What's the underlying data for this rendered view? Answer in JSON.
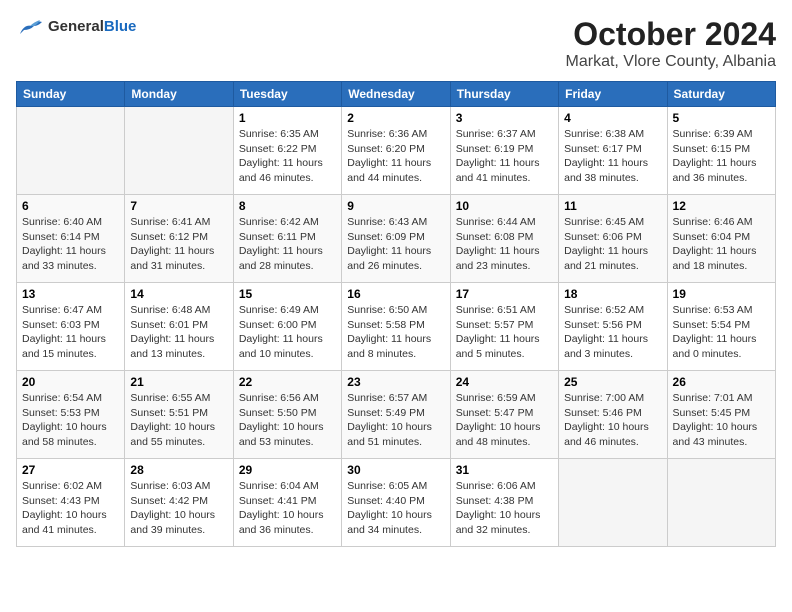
{
  "logo": {
    "general": "General",
    "blue": "Blue"
  },
  "title": "October 2024",
  "subtitle": "Markat, Vlore County, Albania",
  "days_of_week": [
    "Sunday",
    "Monday",
    "Tuesday",
    "Wednesday",
    "Thursday",
    "Friday",
    "Saturday"
  ],
  "weeks": [
    [
      {
        "day": "",
        "sunrise": "",
        "sunset": "",
        "daylight": ""
      },
      {
        "day": "",
        "sunrise": "",
        "sunset": "",
        "daylight": ""
      },
      {
        "day": "1",
        "sunrise": "Sunrise: 6:35 AM",
        "sunset": "Sunset: 6:22 PM",
        "daylight": "Daylight: 11 hours and 46 minutes."
      },
      {
        "day": "2",
        "sunrise": "Sunrise: 6:36 AM",
        "sunset": "Sunset: 6:20 PM",
        "daylight": "Daylight: 11 hours and 44 minutes."
      },
      {
        "day": "3",
        "sunrise": "Sunrise: 6:37 AM",
        "sunset": "Sunset: 6:19 PM",
        "daylight": "Daylight: 11 hours and 41 minutes."
      },
      {
        "day": "4",
        "sunrise": "Sunrise: 6:38 AM",
        "sunset": "Sunset: 6:17 PM",
        "daylight": "Daylight: 11 hours and 38 minutes."
      },
      {
        "day": "5",
        "sunrise": "Sunrise: 6:39 AM",
        "sunset": "Sunset: 6:15 PM",
        "daylight": "Daylight: 11 hours and 36 minutes."
      }
    ],
    [
      {
        "day": "6",
        "sunrise": "Sunrise: 6:40 AM",
        "sunset": "Sunset: 6:14 PM",
        "daylight": "Daylight: 11 hours and 33 minutes."
      },
      {
        "day": "7",
        "sunrise": "Sunrise: 6:41 AM",
        "sunset": "Sunset: 6:12 PM",
        "daylight": "Daylight: 11 hours and 31 minutes."
      },
      {
        "day": "8",
        "sunrise": "Sunrise: 6:42 AM",
        "sunset": "Sunset: 6:11 PM",
        "daylight": "Daylight: 11 hours and 28 minutes."
      },
      {
        "day": "9",
        "sunrise": "Sunrise: 6:43 AM",
        "sunset": "Sunset: 6:09 PM",
        "daylight": "Daylight: 11 hours and 26 minutes."
      },
      {
        "day": "10",
        "sunrise": "Sunrise: 6:44 AM",
        "sunset": "Sunset: 6:08 PM",
        "daylight": "Daylight: 11 hours and 23 minutes."
      },
      {
        "day": "11",
        "sunrise": "Sunrise: 6:45 AM",
        "sunset": "Sunset: 6:06 PM",
        "daylight": "Daylight: 11 hours and 21 minutes."
      },
      {
        "day": "12",
        "sunrise": "Sunrise: 6:46 AM",
        "sunset": "Sunset: 6:04 PM",
        "daylight": "Daylight: 11 hours and 18 minutes."
      }
    ],
    [
      {
        "day": "13",
        "sunrise": "Sunrise: 6:47 AM",
        "sunset": "Sunset: 6:03 PM",
        "daylight": "Daylight: 11 hours and 15 minutes."
      },
      {
        "day": "14",
        "sunrise": "Sunrise: 6:48 AM",
        "sunset": "Sunset: 6:01 PM",
        "daylight": "Daylight: 11 hours and 13 minutes."
      },
      {
        "day": "15",
        "sunrise": "Sunrise: 6:49 AM",
        "sunset": "Sunset: 6:00 PM",
        "daylight": "Daylight: 11 hours and 10 minutes."
      },
      {
        "day": "16",
        "sunrise": "Sunrise: 6:50 AM",
        "sunset": "Sunset: 5:58 PM",
        "daylight": "Daylight: 11 hours and 8 minutes."
      },
      {
        "day": "17",
        "sunrise": "Sunrise: 6:51 AM",
        "sunset": "Sunset: 5:57 PM",
        "daylight": "Daylight: 11 hours and 5 minutes."
      },
      {
        "day": "18",
        "sunrise": "Sunrise: 6:52 AM",
        "sunset": "Sunset: 5:56 PM",
        "daylight": "Daylight: 11 hours and 3 minutes."
      },
      {
        "day": "19",
        "sunrise": "Sunrise: 6:53 AM",
        "sunset": "Sunset: 5:54 PM",
        "daylight": "Daylight: 11 hours and 0 minutes."
      }
    ],
    [
      {
        "day": "20",
        "sunrise": "Sunrise: 6:54 AM",
        "sunset": "Sunset: 5:53 PM",
        "daylight": "Daylight: 10 hours and 58 minutes."
      },
      {
        "day": "21",
        "sunrise": "Sunrise: 6:55 AM",
        "sunset": "Sunset: 5:51 PM",
        "daylight": "Daylight: 10 hours and 55 minutes."
      },
      {
        "day": "22",
        "sunrise": "Sunrise: 6:56 AM",
        "sunset": "Sunset: 5:50 PM",
        "daylight": "Daylight: 10 hours and 53 minutes."
      },
      {
        "day": "23",
        "sunrise": "Sunrise: 6:57 AM",
        "sunset": "Sunset: 5:49 PM",
        "daylight": "Daylight: 10 hours and 51 minutes."
      },
      {
        "day": "24",
        "sunrise": "Sunrise: 6:59 AM",
        "sunset": "Sunset: 5:47 PM",
        "daylight": "Daylight: 10 hours and 48 minutes."
      },
      {
        "day": "25",
        "sunrise": "Sunrise: 7:00 AM",
        "sunset": "Sunset: 5:46 PM",
        "daylight": "Daylight: 10 hours and 46 minutes."
      },
      {
        "day": "26",
        "sunrise": "Sunrise: 7:01 AM",
        "sunset": "Sunset: 5:45 PM",
        "daylight": "Daylight: 10 hours and 43 minutes."
      }
    ],
    [
      {
        "day": "27",
        "sunrise": "Sunrise: 6:02 AM",
        "sunset": "Sunset: 4:43 PM",
        "daylight": "Daylight: 10 hours and 41 minutes."
      },
      {
        "day": "28",
        "sunrise": "Sunrise: 6:03 AM",
        "sunset": "Sunset: 4:42 PM",
        "daylight": "Daylight: 10 hours and 39 minutes."
      },
      {
        "day": "29",
        "sunrise": "Sunrise: 6:04 AM",
        "sunset": "Sunset: 4:41 PM",
        "daylight": "Daylight: 10 hours and 36 minutes."
      },
      {
        "day": "30",
        "sunrise": "Sunrise: 6:05 AM",
        "sunset": "Sunset: 4:40 PM",
        "daylight": "Daylight: 10 hours and 34 minutes."
      },
      {
        "day": "31",
        "sunrise": "Sunrise: 6:06 AM",
        "sunset": "Sunset: 4:38 PM",
        "daylight": "Daylight: 10 hours and 32 minutes."
      },
      {
        "day": "",
        "sunrise": "",
        "sunset": "",
        "daylight": ""
      },
      {
        "day": "",
        "sunrise": "",
        "sunset": "",
        "daylight": ""
      }
    ]
  ]
}
